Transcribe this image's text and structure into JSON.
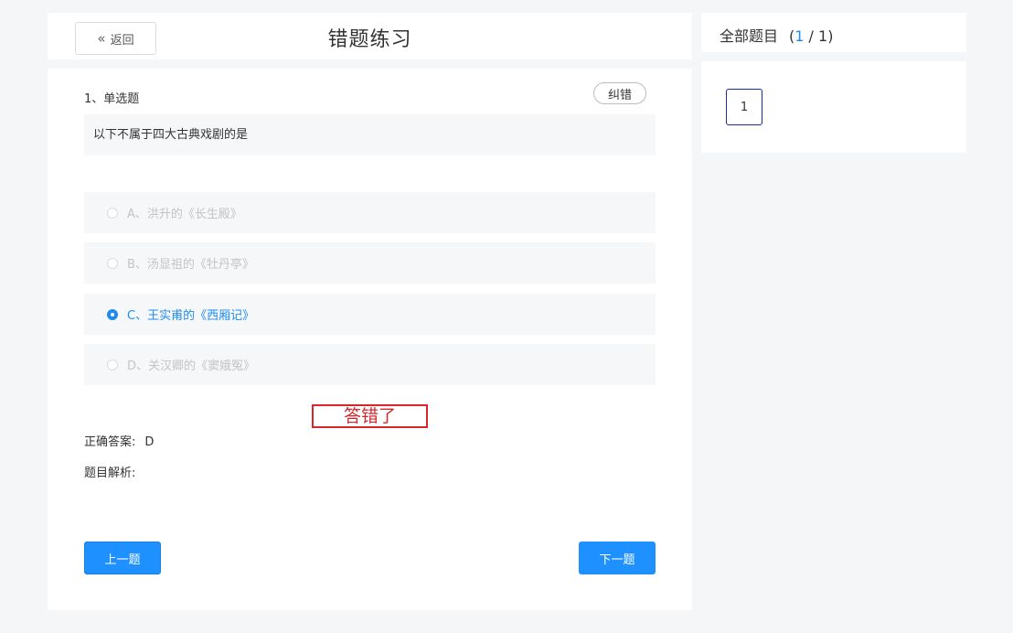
{
  "header": {
    "back_label": "返回",
    "title": "错题练习"
  },
  "question": {
    "type_label": "1、单选题",
    "report_label": "纠错",
    "stem": "以下不属于四大古典戏剧的是",
    "options": [
      {
        "label": "A、洪升的《长生殿》",
        "selected": false
      },
      {
        "label": "B、汤显祖的《牡丹亭》",
        "selected": false
      },
      {
        "label": "C、王实甫的《西厢记》",
        "selected": true
      },
      {
        "label": "D、关汉卿的《窦娥冤》",
        "selected": false
      }
    ],
    "result_text": "答错了",
    "correct_answer_label": "正确答案:",
    "correct_answer_value": "D",
    "analysis_label": "题目解析:"
  },
  "navigation": {
    "prev_label": "上一题",
    "next_label": "下一题"
  },
  "sidebar": {
    "title": "全部题目",
    "count_open": "(",
    "current": "1",
    "separator": " / ",
    "total": "1",
    "count_close": ")",
    "question_numbers": [
      "1"
    ]
  },
  "colors": {
    "accent": "#1f8ceb",
    "button": "#1e90ff",
    "error": "#d9262b",
    "selected_border": "#1c2aa3"
  }
}
